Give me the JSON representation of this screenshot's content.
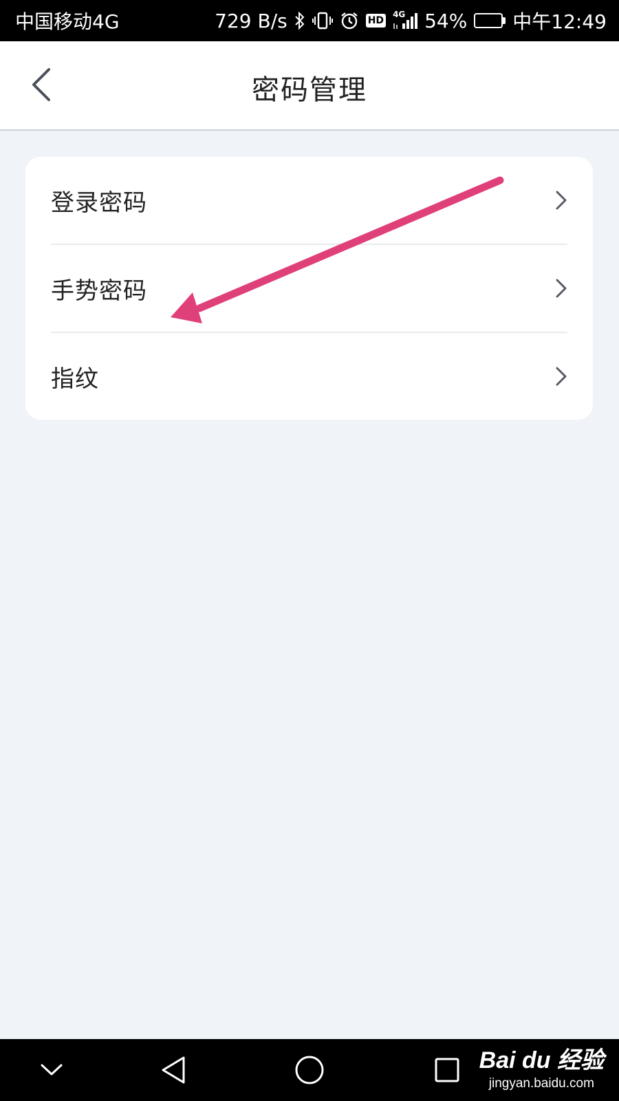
{
  "status_bar": {
    "carrier": "中国移动4G",
    "network_speed": "729 B/s",
    "hd_label": "HD",
    "network_type": "4G",
    "battery_percent": "54%",
    "battery_level": 0.54,
    "time": "中午12:49",
    "icons": [
      "bluetooth-icon",
      "vibrate-icon",
      "alarm-icon",
      "hd-icon",
      "signal-icon",
      "battery-icon"
    ]
  },
  "header": {
    "title": "密码管理",
    "back_icon": "chevron-left-icon"
  },
  "menu": {
    "items": [
      {
        "label": "登录密码",
        "icon": "chevron-right-icon"
      },
      {
        "label": "手势密码",
        "icon": "chevron-right-icon"
      },
      {
        "label": "指纹",
        "icon": "chevron-right-icon"
      }
    ]
  },
  "annotation": {
    "type": "arrow",
    "color": "#e0407a",
    "points_to": "手势密码"
  },
  "nav_bar": {
    "buttons": [
      "chevron-down-icon",
      "back-triangle-icon",
      "home-circle-icon",
      "recents-square-icon"
    ]
  },
  "watermark": {
    "logo": "Bai du 经验",
    "url": "jingyan.baidu.com"
  },
  "colors": {
    "background": "#f0f4f9",
    "card": "#ffffff",
    "status_bar": "#000000",
    "arrow": "#e0407a"
  }
}
